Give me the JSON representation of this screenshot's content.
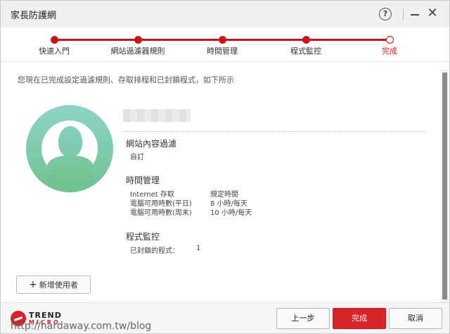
{
  "window": {
    "title": "家長防護網",
    "help_symbol": "?",
    "close_symbol": "✕"
  },
  "steps": [
    {
      "label": "快速入門"
    },
    {
      "label": "網站過濾器規則"
    },
    {
      "label": "時間管理"
    },
    {
      "label": "程式監控"
    },
    {
      "label": "完成"
    }
  ],
  "description": "您現在已完成設定過濾規則、存取排程和已封鎖程式，如下所示",
  "summary": {
    "web_filter": {
      "heading": "網站內容過濾",
      "value": "自訂"
    },
    "time": {
      "heading": "時間管理",
      "rows": [
        {
          "label": "Internet 存取",
          "value": "規定時間"
        },
        {
          "label": "電腦可用時數(平日)",
          "value": "8 小時/每天"
        },
        {
          "label": "電腦可用時數(周末)",
          "value": "10 小時/每天"
        }
      ]
    },
    "apps": {
      "heading": "程式監控",
      "rows": [
        {
          "label": "已封鎖的程式：",
          "value": "1"
        }
      ]
    }
  },
  "add_user": {
    "plus": "+",
    "label": "新增使用者"
  },
  "logo": {
    "line1": "TREND",
    "line2": "MICRO"
  },
  "watermark": "http://hardaway.com.tw/blog",
  "buttons": {
    "back": "上一步",
    "finish": "完成",
    "cancel": "取消"
  },
  "colors": {
    "accent": "#d9232a",
    "avatar_top": "#8fd3c9",
    "avatar_bottom": "#6fc38f"
  }
}
